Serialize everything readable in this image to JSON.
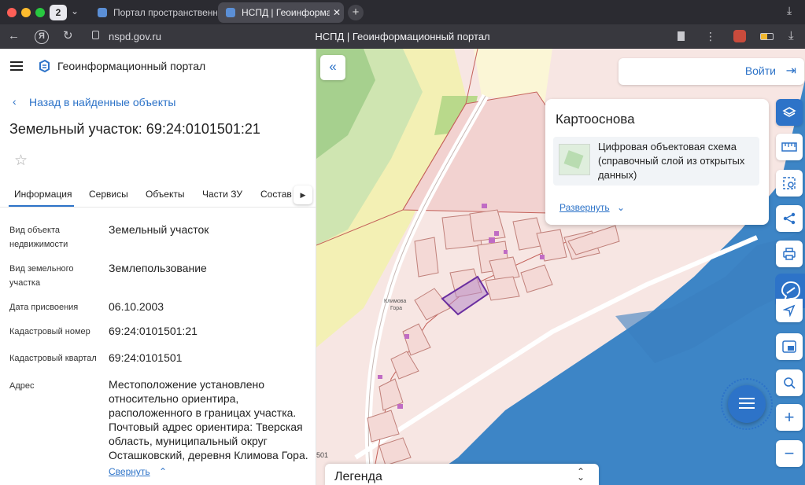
{
  "browser": {
    "tab_count": "2",
    "tabs": [
      {
        "title": "Портал пространственн"
      },
      {
        "title": "НСПД | Геоинформаци"
      }
    ],
    "url": "nspd.gov.ru",
    "page_title": "НСПД | Геоинформационный портал"
  },
  "portal": {
    "name": "Геоинформационный портал",
    "back_link": "Назад в найденные объекты",
    "object_title": "Земельный участок: 69:24:0101501:21",
    "tabs": [
      "Информация",
      "Сервисы",
      "Объекты",
      "Части ЗУ",
      "Состав"
    ],
    "properties": [
      {
        "label_1": "Вид объекта",
        "label_2": "недвижимости",
        "value": "Земельный участок"
      },
      {
        "label_1": "Вид земельного",
        "label_2": "участка",
        "value": "Землепользование"
      },
      {
        "label_1": "Дата присвоения",
        "value": "06.10.2003"
      },
      {
        "label_1": "Кадастровый номер",
        "value": "69:24:0101501:21"
      },
      {
        "label_1": "Кадастровый квартал",
        "value": "69:24:0101501"
      }
    ],
    "address_label": "Адрес",
    "address_lines": [
      "Местоположение установлено",
      "относительно ориентира,",
      "расположенного в границах участка.",
      "Почтовый адрес ориентира: Тверская",
      "область, муниципальный округ",
      "Осташковский, деревня Климова Гора."
    ],
    "collapse_link": "Свернуть"
  },
  "map": {
    "login_button": "Войти",
    "basemap_title": "Картооснова",
    "basemap_layer_lines": [
      "Цифровая объектовая схема",
      "(справочный слой из открытых",
      "данных)"
    ],
    "expand_link": "Развернуть",
    "village_label_1": "Климова",
    "village_label_2": "Гора",
    "edge_number": "501",
    "legend_title": "Легенда",
    "water_color": "#3d85c6",
    "parcel_color": "#f2dedc",
    "selected_color": "#6b2fa0"
  },
  "icons": {
    "collapse_panel": "double-chevron-left-icon",
    "layers": "layers-icon",
    "ruler": "ruler-icon",
    "select_area": "select-area-icon",
    "share": "share-icon",
    "print": "print-icon",
    "location": "location-arrow-icon",
    "minimap": "minimap-icon",
    "search_area": "search-area-icon",
    "zoom_in": "plus-icon",
    "zoom_out": "minus-icon",
    "chat": "chat-icon"
  }
}
